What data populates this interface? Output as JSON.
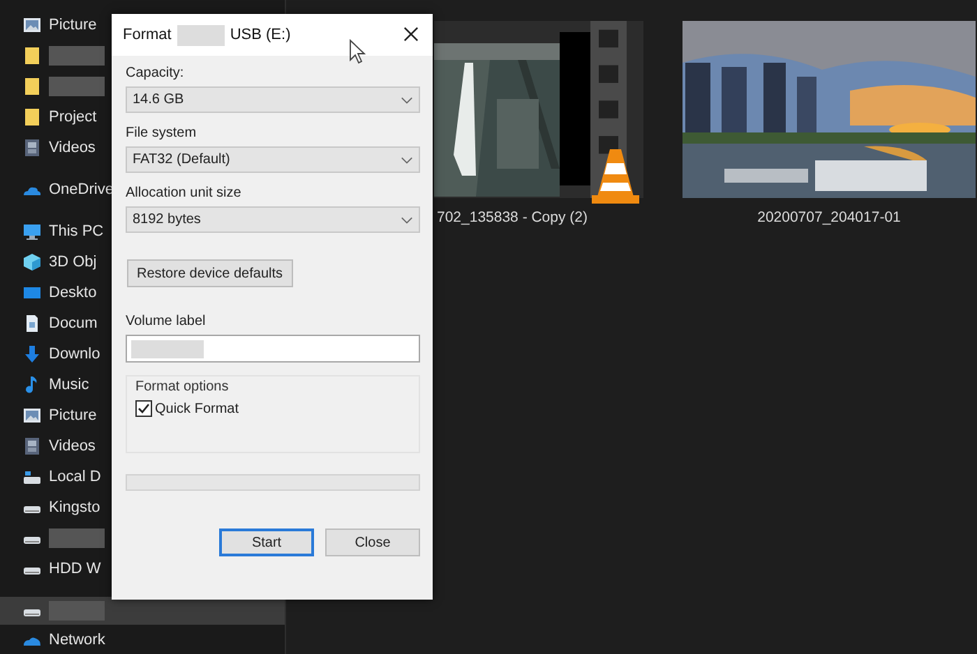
{
  "sidebar": {
    "items": [
      {
        "label": "Picture",
        "selected": false
      },
      {
        "kind": "blurred",
        "selected": false
      },
      {
        "kind": "blurred",
        "selected": false
      },
      {
        "label": "Project",
        "selected": false
      },
      {
        "label": "Videos",
        "selected": false
      },
      {
        "label": "OneDrive",
        "selected": false
      },
      {
        "label": "This PC",
        "selected": false
      },
      {
        "label": "3D Obj",
        "selected": false
      },
      {
        "label": "Deskto",
        "selected": false
      },
      {
        "label": "Docum",
        "selected": false
      },
      {
        "label": "Downlo",
        "selected": false
      },
      {
        "label": "Music",
        "selected": false
      },
      {
        "label": "Picture",
        "selected": false
      },
      {
        "label": "Videos",
        "selected": false
      },
      {
        "label": "Local D",
        "selected": false
      },
      {
        "label": "Kingsto",
        "selected": false
      },
      {
        "kind": "blurred",
        "selected": false
      },
      {
        "label": "HDD W",
        "selected": false
      },
      {
        "kind": "blurred",
        "selected": true
      },
      {
        "label": "Network",
        "selected": false
      }
    ]
  },
  "files": [
    {
      "name": "702_135838 - Copy (2)",
      "kind": "video"
    },
    {
      "name": "20200707_204017-01"
    }
  ],
  "dialog": {
    "title_start": "Format",
    "title_end": "USB (E:)",
    "dropdowns": [
      {
        "label": "Capacity:",
        "value": "14.6 GB"
      },
      {
        "label": "File system",
        "value": "FAT32 (Default)"
      },
      {
        "label": "Allocation unit size",
        "value": "8192 bytes"
      }
    ],
    "restore_button": "Restore device defaults",
    "volume_label": {
      "label": "Volume label"
    },
    "format_options": {
      "title": "Format options",
      "quick_format": {
        "label": "Quick Format",
        "checked": true
      }
    },
    "progress": {
      "level": 0
    },
    "buttons": [
      {
        "label": "Start",
        "focused": true
      },
      {
        "label": "Close",
        "focused": false
      }
    ]
  }
}
